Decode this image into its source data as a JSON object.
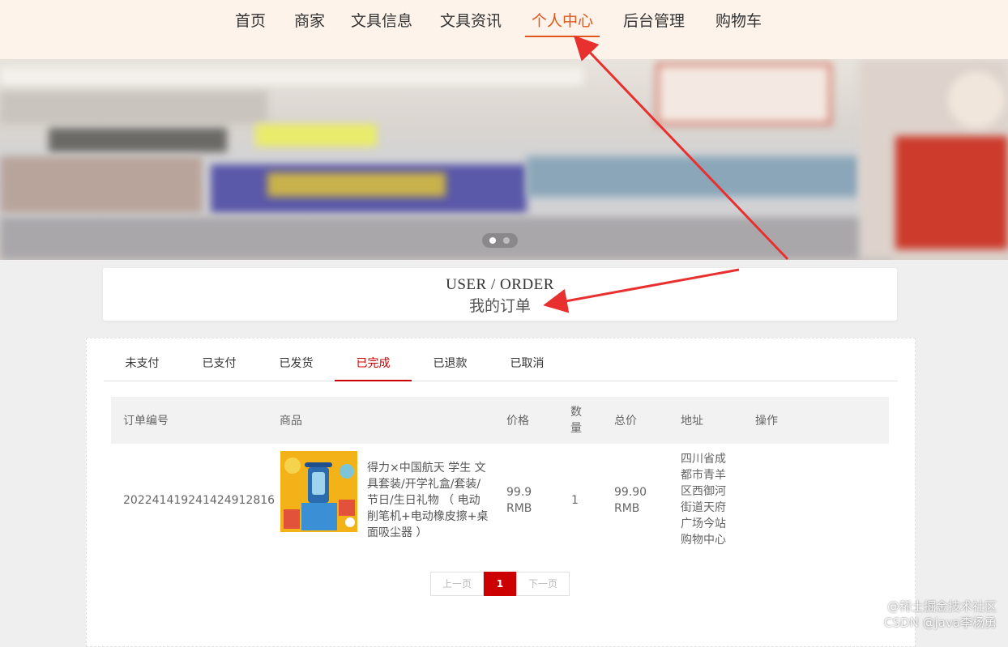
{
  "nav": {
    "items": [
      {
        "label": "首页"
      },
      {
        "label": "商家"
      },
      {
        "label": "文具信息"
      },
      {
        "label": "文具资讯"
      },
      {
        "label": "个人中心",
        "active": true
      },
      {
        "label": "后台管理"
      },
      {
        "label": "购物车"
      }
    ],
    "active_color": "#e0561a"
  },
  "banner": {
    "carousel_index": 1,
    "carousel_count": 2
  },
  "heading": {
    "en": "USER / ORDER",
    "cn": "我的订单"
  },
  "tabs": {
    "items": [
      {
        "label": "未支付"
      },
      {
        "label": "已支付"
      },
      {
        "label": "已发货"
      },
      {
        "label": "已完成",
        "active": true
      },
      {
        "label": "已退款"
      },
      {
        "label": "已取消"
      }
    ],
    "active_color": "#cc0000"
  },
  "table": {
    "headers": {
      "order_no": "订单编号",
      "product": "商品",
      "price": "价格",
      "qty": "数量",
      "total": "总价",
      "address": "地址",
      "action": "操作"
    },
    "rows": [
      {
        "order_no": "202241419241424912816",
        "product_name": "得力×中国航天 学生 文具套装/开学礼盒/套装/节日/生日礼物 （ 电动削笔机+电动橡皮擦+桌面吸尘器 ）",
        "price": "99.9 RMB",
        "qty": "1",
        "total": "99.90 RMB",
        "address": "四川省成都市青羊区西御河街道天府广场今站购物中心"
      }
    ]
  },
  "pager": {
    "prev": "上一页",
    "current": "1",
    "next": "下一页"
  },
  "watermark": {
    "line1": "@稀土掘金技术社区",
    "line2": "CSDN @java李杨勇"
  },
  "annotation_color": "#e8302f"
}
